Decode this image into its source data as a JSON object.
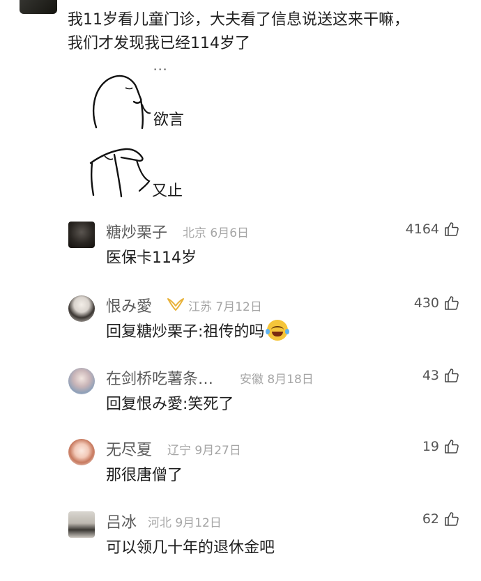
{
  "post": {
    "text_line1": "我11岁看儿童门诊，大夫看了信息说送这来干嘛，",
    "text_line2": "我们才发现我已经114岁了",
    "sticker1_caption": "欲言",
    "sticker1_dots": "···",
    "sticker2_caption": "又止"
  },
  "comments": [
    {
      "name": "糖炒栗子",
      "meta": "北京 6月6日",
      "text": "医保卡114岁",
      "likes": "4164",
      "avatar_icon": "user-avatar"
    },
    {
      "name": "恨み愛",
      "meta": "江苏 7月12日",
      "text": "回复糖炒栗子:祖传的吗",
      "likes": "430",
      "avatar_icon": "user-avatar",
      "badge_icon": "badge-icon",
      "emoji_icon": "laugh-cry-emoji"
    },
    {
      "name": "在剑桥吃薯条…",
      "meta": "安徽 8月18日",
      "text": "回复恨み愛:笑死了",
      "likes": "43",
      "avatar_icon": "user-avatar"
    },
    {
      "name": "无尽夏",
      "meta": "辽宁 9月27日",
      "text": "那很唐僧了",
      "likes": "19",
      "avatar_icon": "user-avatar"
    },
    {
      "name": "吕冰",
      "meta": "河北 9月12日",
      "text": "可以领几十年的退休金吧",
      "likes": "62",
      "avatar_icon": "user-avatar"
    }
  ],
  "icons": {
    "like": "thumbs-up-icon"
  },
  "colors": {
    "name": "#5b5b5b",
    "meta": "#a5a5a5",
    "text": "#1e1e1e",
    "badge": "#e8b23a"
  }
}
